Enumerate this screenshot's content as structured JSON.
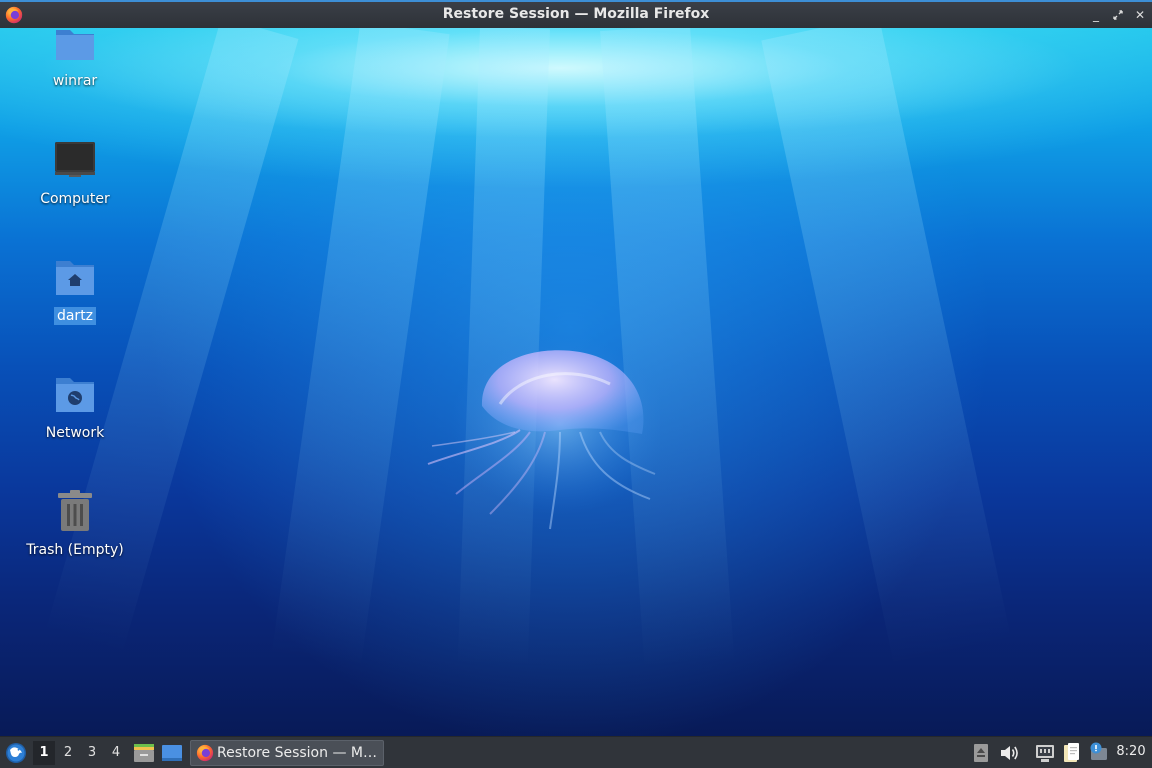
{
  "window": {
    "title": "Restore Session — Mozilla Firefox",
    "app_icon": "firefox-icon",
    "controls": {
      "minimize": "minimize-icon",
      "maximize": "restore-icon",
      "close": "close-icon"
    }
  },
  "desktop": {
    "icons": [
      {
        "label": "winrar",
        "icon": "folder-icon",
        "selected": false
      },
      {
        "label": "Computer",
        "icon": "computer-icon",
        "selected": false
      },
      {
        "label": "dartz",
        "icon": "home-folder-icon",
        "selected": true
      },
      {
        "label": "Network",
        "icon": "network-folder-icon",
        "selected": false
      },
      {
        "label": "Trash (Empty)",
        "icon": "trash-icon",
        "selected": false
      }
    ],
    "wallpaper": "underwater-jellyfish"
  },
  "taskbar": {
    "menu_icon": "xfce-menu-icon",
    "workspaces": [
      "1",
      "2",
      "3",
      "4"
    ],
    "active_workspace": "1",
    "quick_launch": [
      "file-manager-icon",
      "show-desktop-icon"
    ],
    "tasks": [
      {
        "label": "Restore Session — M…",
        "icon": "firefox-icon",
        "active": true
      }
    ],
    "tray": [
      "disk-icon",
      "volume-icon",
      "network-wired-icon",
      "clipboard-icon",
      "notification-icon"
    ],
    "clock": "8:20"
  },
  "colors": {
    "selection": "#3f8fe0",
    "titlebar_accent": "#3d8fd6",
    "panel": "#30343a"
  }
}
